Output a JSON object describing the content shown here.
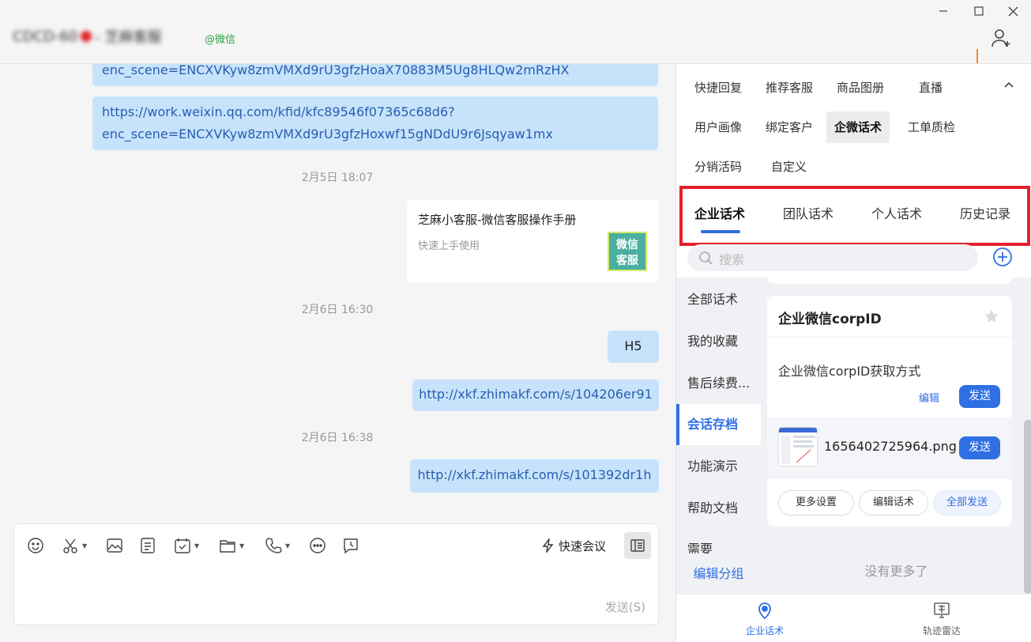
{
  "window": {
    "minimize_icon": "minimize-icon",
    "maximize_icon": "maximize-icon",
    "close_icon": "close-icon"
  },
  "header": {
    "contact_name_left": "CDCD-60",
    "contact_name_right": "- 芝麻客服",
    "contact_tag": "@微信",
    "add_member_icon": "add-member-icon"
  },
  "chat": {
    "messages": [
      {
        "type": "link",
        "text": "enc_scene=ENCXVKyw8zmVMXd9rU3gfzHoaX70883M5Ug8HLQw2mRzHX"
      },
      {
        "type": "link",
        "line1": "https://work.weixin.qq.com/kfid/kfc89546f07365c68d6?",
        "line2": "enc_scene=ENCXVKyw8zmVMXd9rU3gfzHoxwf15gNDdU9r6Jsqyaw1mx"
      },
      {
        "type": "timestamp",
        "text": "2月5日 18:07"
      },
      {
        "type": "card",
        "title": "芝麻小客服-微信客服操作手册",
        "subtitle": "快速上手使用",
        "thumb_line1": "微信",
        "thumb_line2": "客服"
      },
      {
        "type": "timestamp",
        "text": "2月6日 16:30"
      },
      {
        "type": "text",
        "text": "H5"
      },
      {
        "type": "link",
        "text": "http://xkf.zhimakf.com/s/104206er91"
      },
      {
        "type": "timestamp",
        "text": "2月6日 16:38"
      },
      {
        "type": "link",
        "text": "http://xkf.zhimakf.com/s/101392dr1h"
      }
    ]
  },
  "input": {
    "toolbar_icons": [
      "emoji-icon",
      "scissors-icon",
      "image-icon",
      "document-icon",
      "task-icon",
      "folder-icon",
      "phone-icon",
      "more-icon",
      "chat-record-icon"
    ],
    "quick_meeting_label": "快速会议",
    "send_hint": "发送(S)"
  },
  "right_panel": {
    "function_tabs": [
      {
        "label": "快捷回复"
      },
      {
        "label": "推荐客服"
      },
      {
        "label": "商品图册"
      },
      {
        "label": "直播"
      },
      {
        "label": "用户画像"
      },
      {
        "label": "绑定客户"
      },
      {
        "label": "企微话术"
      },
      {
        "label": "工单质检"
      },
      {
        "label": "分销活码"
      },
      {
        "label": "自定义"
      }
    ],
    "active_function_tab": "企微话术",
    "script_tabs": [
      {
        "label": "企业话术"
      },
      {
        "label": "团队话术"
      },
      {
        "label": "个人话术"
      },
      {
        "label": "历史记录"
      }
    ],
    "active_script_tab": "企业话术",
    "search_placeholder": "搜索",
    "categories": [
      {
        "label": "全部话术"
      },
      {
        "label": "我的收藏"
      },
      {
        "label": "售后续费..."
      },
      {
        "label": "会话存档"
      },
      {
        "label": "功能演示"
      },
      {
        "label": "帮助文档"
      },
      {
        "label": "需要"
      }
    ],
    "active_category": "会话存档",
    "edit_group_label": "编辑分组",
    "script_card": {
      "title": "企业微信corpID",
      "text": "企业微信corpID获取方式",
      "edit_label": "编辑",
      "send_label": "发送",
      "file_name": "1656402725964.png",
      "file_send_label": "发送",
      "more_settings_label": "更多设置",
      "edit_script_label": "编辑话术",
      "send_all_label": "全部发送"
    },
    "no_more_label": "没有更多了",
    "bottom_nav": [
      {
        "label": "企业话术",
        "active": true
      },
      {
        "label": "轨迹雷达",
        "active": false
      }
    ]
  },
  "colors": {
    "accent": "#2f6fe4",
    "bubble": "#c6e3fb",
    "highlight_border": "#e3202c",
    "tag_green": "#2ba245"
  }
}
